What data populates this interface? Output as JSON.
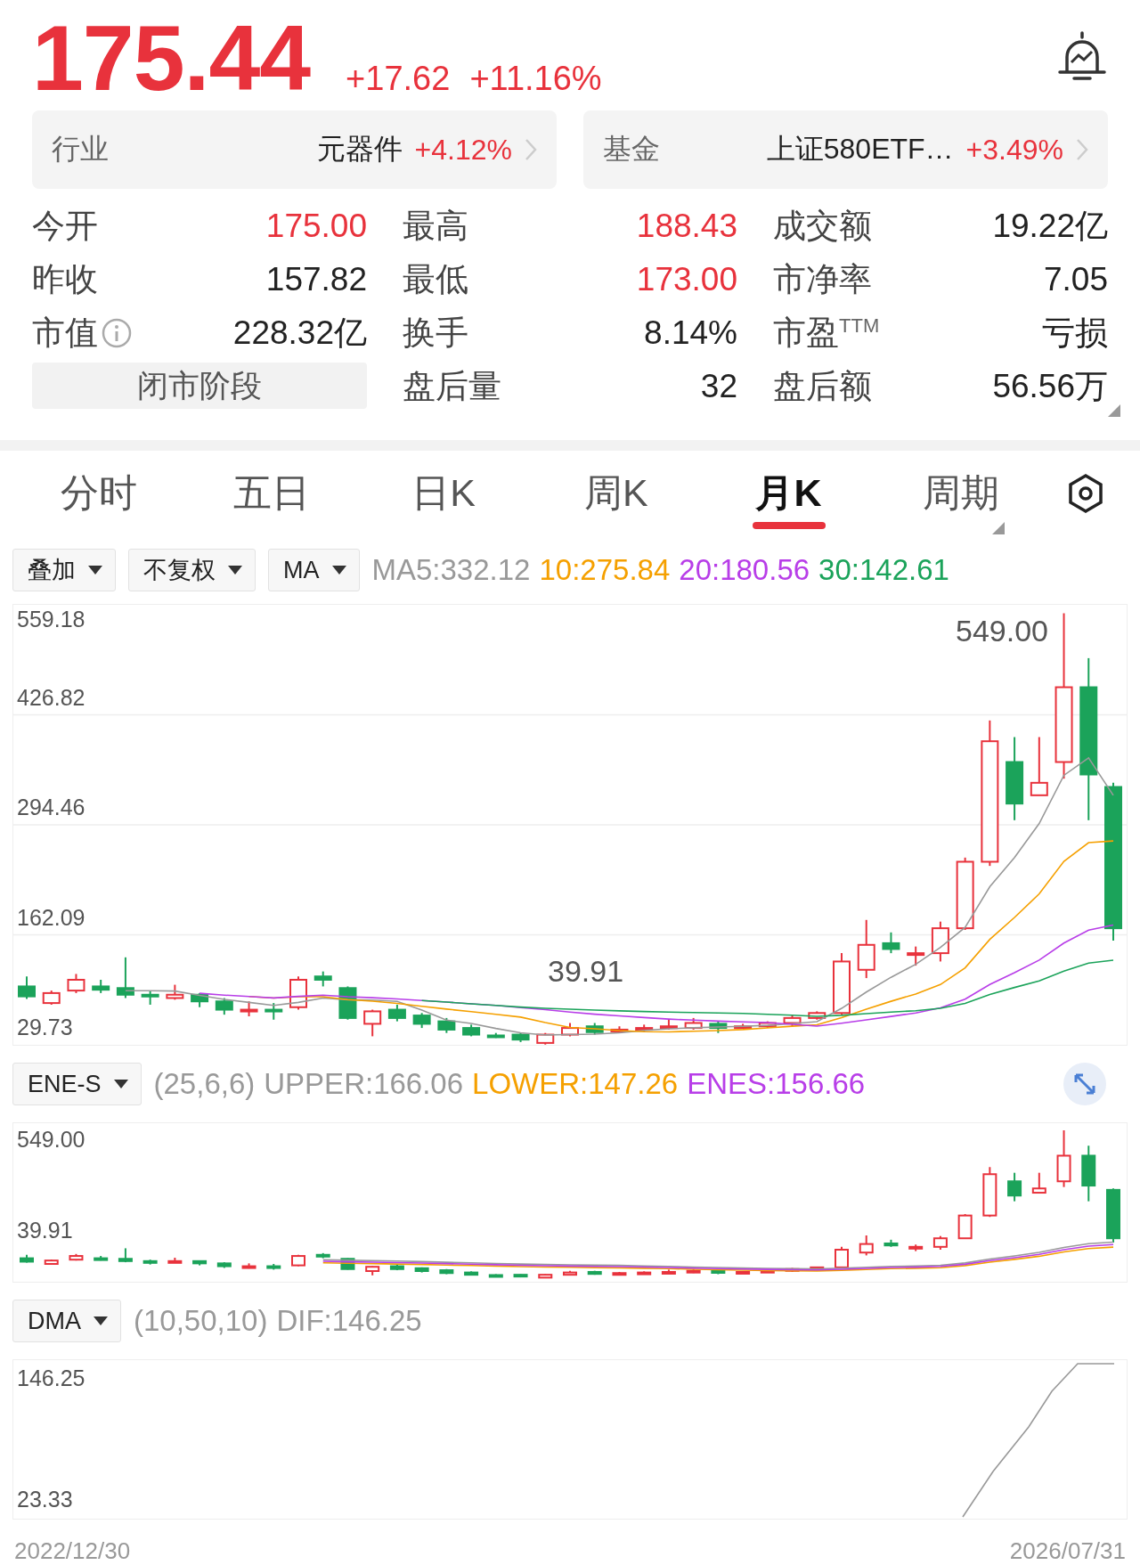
{
  "quote": {
    "price": "175.44",
    "change": "+17.62",
    "change_pct": "+11.16%"
  },
  "cards": [
    {
      "label": "行业",
      "name": "元器件",
      "change": "+4.12%"
    },
    {
      "label": "基金",
      "name": "上证580ETF…",
      "change": "+3.49%"
    }
  ],
  "stats": [
    [
      {
        "label": "今开",
        "value": "175.00",
        "rising": true
      },
      {
        "label": "昨收",
        "value": "157.82",
        "rising": false
      },
      {
        "label": "市值",
        "value": "228.32亿",
        "rising": false,
        "info": true
      },
      {
        "kind": "button",
        "label": "闭市阶段"
      }
    ],
    [
      {
        "label": "最高",
        "value": "188.43",
        "rising": true
      },
      {
        "label": "最低",
        "value": "173.00",
        "rising": true
      },
      {
        "label": "换手",
        "value": "8.14%",
        "rising": false
      },
      {
        "label": "盘后量",
        "value": "32",
        "rising": false
      }
    ],
    [
      {
        "label": "成交额",
        "value": "19.22亿",
        "rising": false
      },
      {
        "label": "市净率",
        "value": "7.05",
        "rising": false
      },
      {
        "label": "市盈$^{TTM}$",
        "value": "亏损",
        "rising": false
      },
      {
        "label": "盘后额",
        "value": "56.56万",
        "rising": false
      }
    ]
  ],
  "tabs": [
    {
      "label": "分时",
      "selected": false
    },
    {
      "label": "五日",
      "selected": false
    },
    {
      "label": "日K",
      "selected": false
    },
    {
      "label": "周K",
      "selected": false
    },
    {
      "label": "月K",
      "selected": true
    },
    {
      "label": "周期",
      "selected": false
    }
  ],
  "toolbar": {
    "dropdowns": [
      "叠加",
      "不复权",
      "MA"
    ],
    "legend": [
      {
        "text": "MA5:332.12",
        "color": "#999999"
      },
      {
        "text": "10:275.84",
        "color": "#f5a000"
      },
      {
        "text": "20:180.56",
        "color": "#b83ee8"
      },
      {
        "text": "30:142.61",
        "color": "#1ba35a"
      }
    ]
  },
  "main_chart": {
    "y_labels": [
      "559.18",
      "426.82",
      "294.46",
      "162.09",
      "29.73"
    ],
    "high_label": "549.00",
    "low_label": "39.91"
  },
  "ene": {
    "dropdown": "ENE-S",
    "params": "(25,6,6)",
    "legend": [
      {
        "text": "UPPER:166.06",
        "color": "#999999"
      },
      {
        "text": "LOWER:147.26",
        "color": "#f5a000"
      },
      {
        "text": "ENES:156.66",
        "color": "#b83ee8"
      }
    ],
    "y_labels": [
      "549.00",
      "39.91"
    ]
  },
  "dma": {
    "dropdown": "DMA",
    "params": "(10,50,10)",
    "legend": [
      {
        "text": "DIF:146.25",
        "color": "#999999"
      }
    ],
    "y_labels": [
      "146.25",
      "23.33"
    ]
  },
  "dates": [
    "2022/12/30",
    "2026/07/31"
  ]
}
